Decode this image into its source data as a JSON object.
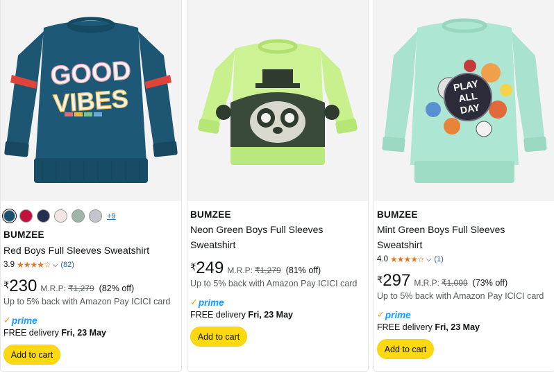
{
  "products": [
    {
      "image_alt": "Blue sweatshirt with GOOD VIBES graphic",
      "swatches": [
        "#1a4f6e",
        "#c0123c",
        "#232f4e",
        "#f2e6e4",
        "#9fb6a6",
        "#c4c4cc"
      ],
      "swatch_more": "+9",
      "brand": "BUMZEE",
      "title": "Red Boys Full Sleeves Sweatshirt",
      "rating": "3.9",
      "stars": "★★★★☆",
      "review_count": "(82)",
      "currency": "₹",
      "price": "230",
      "mrp_label": "M.R.P:",
      "mrp": "₹1,279",
      "discount": "(82% off)",
      "cashback": "Up to 5% back with Amazon Pay ICICI card",
      "prime_label": "prime",
      "delivery_prefix": "FREE delivery",
      "delivery_date": "Fri, 23 May",
      "cart_label": "Add to cart"
    },
    {
      "image_alt": "Neon green sweatshirt with panda graphic",
      "brand": "BUMZEE",
      "title_line1": "Neon Green Boys Full Sleeves",
      "title_line2": "Sweatshirt",
      "currency": "₹",
      "price": "249",
      "mrp_label": "M.R.P:",
      "mrp": "₹1,279",
      "discount": "(81% off)",
      "cashback": "Up to 5% back with Amazon Pay ICICI card",
      "prime_label": "prime",
      "delivery_prefix": "FREE delivery",
      "delivery_date": "Fri, 23 May",
      "cart_label": "Add to cart"
    },
    {
      "image_alt": "Mint green sweatshirt with PLAY ALL DAY graphic",
      "brand": "BUMZEE",
      "title_line1": "Mint Green Boys Full Sleeves",
      "title_line2": "Sweatshirt",
      "rating": "4.0",
      "stars": "★★★★☆",
      "review_count": "(1)",
      "currency": "₹",
      "price": "297",
      "mrp_label": "M.R.P:",
      "mrp": "₹1,099",
      "discount": "(73% off)",
      "cashback": "Up to 5% back with Amazon Pay ICICI card",
      "prime_label": "prime",
      "delivery_prefix": "FREE delivery",
      "delivery_date": "Fri, 23 May",
      "cart_label": "Add to cart"
    }
  ],
  "graphics": {
    "card1_text_top": "GOOD",
    "card1_text_bottom": "VIBES",
    "card3_text_1": "PLAY",
    "card3_text_2": "ALL",
    "card3_text_3": "DAY"
  },
  "colors": {
    "price_accent": "#0f1111",
    "star": "#de7921",
    "link": "#2162a1",
    "prime_blue": "#1399ff",
    "cart_button": "#ffd814"
  }
}
